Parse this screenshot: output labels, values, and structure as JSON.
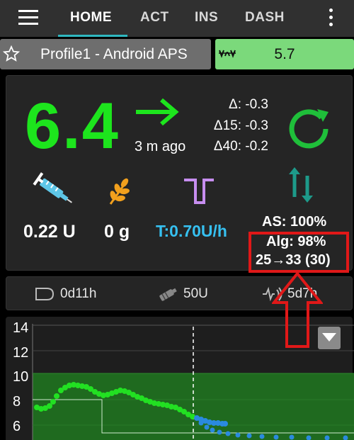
{
  "appbar": {
    "tabs": [
      {
        "label": "HOME",
        "active": true
      },
      {
        "label": "ACT",
        "active": false
      },
      {
        "label": "INS",
        "active": false
      },
      {
        "label": "DASH",
        "active": false
      }
    ],
    "accent_color": "#2fb8c0"
  },
  "profile": {
    "label": "Profile1 - Android APS",
    "icon": "star-icon"
  },
  "target": {
    "value": "5.7",
    "icon": "target-wave-icon",
    "color": "#7bd97b"
  },
  "bg": {
    "value": "6.4",
    "color": "#1de51d",
    "trend": "flat-right-arrow",
    "time_ago": "3 m ago",
    "delta": "Δ: -0.3",
    "delta15": "Δ15: -0.3",
    "delta40": "Δ40: -0.2"
  },
  "treatments": {
    "iob": "0.22 U",
    "cob": "0 g",
    "temp_basal": "T:0.70U/h",
    "temp_basal_color": "#36c0f0",
    "autosens": "AS: 100%",
    "algorithm": "Alg: 98%",
    "range": "25→33 (30)"
  },
  "status": {
    "cannula_age": "0d11h",
    "reservoir": "50U",
    "sensor_age": "5d7h"
  },
  "graph": {
    "y_ticks": [
      "14",
      "12",
      "10",
      "8",
      "6"
    ],
    "target_range_color": "#1f6a1f",
    "bg_color": "#22e022",
    "prediction_color": "#2a8adf"
  }
}
